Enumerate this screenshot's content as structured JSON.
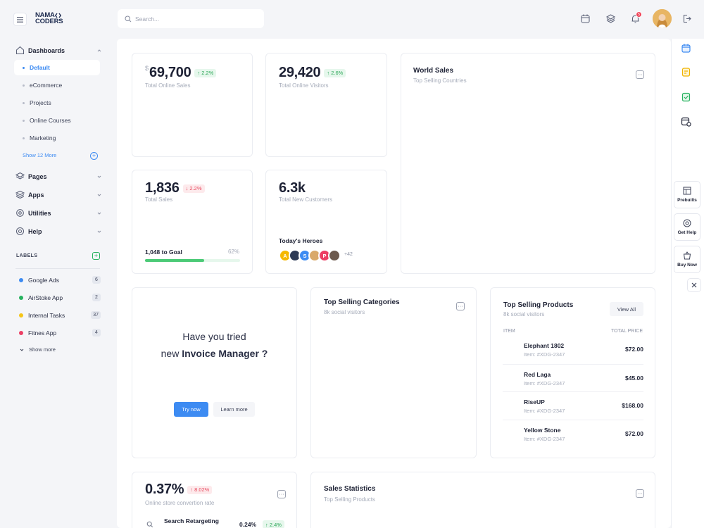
{
  "brand": {
    "logo_line1": "NAMA",
    "logo_line2": "CODERS"
  },
  "sidebar": {
    "dashboards": "Dashboards",
    "items": [
      {
        "label": "Default"
      },
      {
        "label": "eCommerce"
      },
      {
        "label": "Projects"
      },
      {
        "label": "Online Courses"
      },
      {
        "label": "Marketing"
      }
    ],
    "show_more": "Show 12 More",
    "sections": [
      {
        "label": "Pages"
      },
      {
        "label": "Apps"
      },
      {
        "label": "Utilities"
      },
      {
        "label": "Help"
      }
    ],
    "labels_heading": "LABELS",
    "labels": [
      {
        "name": "Google Ads",
        "count": "6",
        "color": "#3d8bf2"
      },
      {
        "name": "AirStoke App",
        "count": "2",
        "color": "#27b25f"
      },
      {
        "name": "Internal Tasks",
        "count": "37",
        "color": "#f5c518"
      },
      {
        "name": "Fitnes App",
        "count": "4",
        "color": "#ec3f64"
      }
    ],
    "labels_more": "Show more"
  },
  "header": {
    "search_placeholder": "Search...",
    "notif_count": "5"
  },
  "stats": {
    "online_sales": {
      "currency": "$",
      "value": "69,700",
      "delta": "2.2%",
      "label": "Total Online Sales"
    },
    "visitors": {
      "value": "29,420",
      "delta": "2.6%",
      "label": "Total Online Visitors"
    },
    "sales": {
      "value": "1,836",
      "delta": "2.2%",
      "label": "Total Sales",
      "goal_label": "1,048 to Goal",
      "goal_pct": "62%",
      "goal_fraction": 0.62
    },
    "customers": {
      "value": "6.3k",
      "label": "Total New Customers",
      "heroes_title": "Today's Heroes",
      "heroes": [
        {
          "initial": "A",
          "color": "#f5b800"
        },
        {
          "initial": "",
          "color": "#2d3a55"
        },
        {
          "initial": "S",
          "color": "#3d8bf2"
        },
        {
          "initial": "",
          "color": "#d9a96a"
        },
        {
          "initial": "P",
          "color": "#ec3f64"
        },
        {
          "initial": "",
          "color": "#6d5a4e"
        }
      ],
      "heroes_more": "+42"
    }
  },
  "world_sales": {
    "title": "World Sales",
    "subtitle": "Top Selling Countries"
  },
  "promo": {
    "line1": "Have you tried",
    "line2_prefix": "new ",
    "line2_bold": "Invoice Manager ?",
    "try_now": "Try now",
    "learn_more": "Learn more"
  },
  "top_categories": {
    "title": "Top Selling Categories",
    "subtitle": "8k social visitors"
  },
  "top_products": {
    "title": "Top Selling Products",
    "subtitle": "8k social visitors",
    "view_all": "View All",
    "col_item": "ITEM",
    "col_price": "TOTAL PRICE",
    "rows": [
      {
        "name": "Elephant 1802",
        "item": "Item: #XDG-2347",
        "price": "$72.00"
      },
      {
        "name": "Red Laga",
        "item": "Item: #XDG-2347",
        "price": "$45.00"
      },
      {
        "name": "RiseUP",
        "item": "Item: #XDG-2347",
        "price": "$168.00"
      },
      {
        "name": "Yellow Stone",
        "item": "Item: #XDG-2347",
        "price": "$72.00"
      }
    ]
  },
  "conversion": {
    "value": "0.37%",
    "delta": "8.02%",
    "label": "Online store convertion rate",
    "row_name": "Search Retargeting",
    "row_value": "0.24%",
    "row_delta": "2.4%"
  },
  "sales_stats": {
    "title": "Sales Statistics",
    "subtitle": "Top Selling Products"
  },
  "rightbar": {
    "prebuilts": "Prebuilts",
    "get_help": "Get Help",
    "buy_now": "Buy Now"
  }
}
